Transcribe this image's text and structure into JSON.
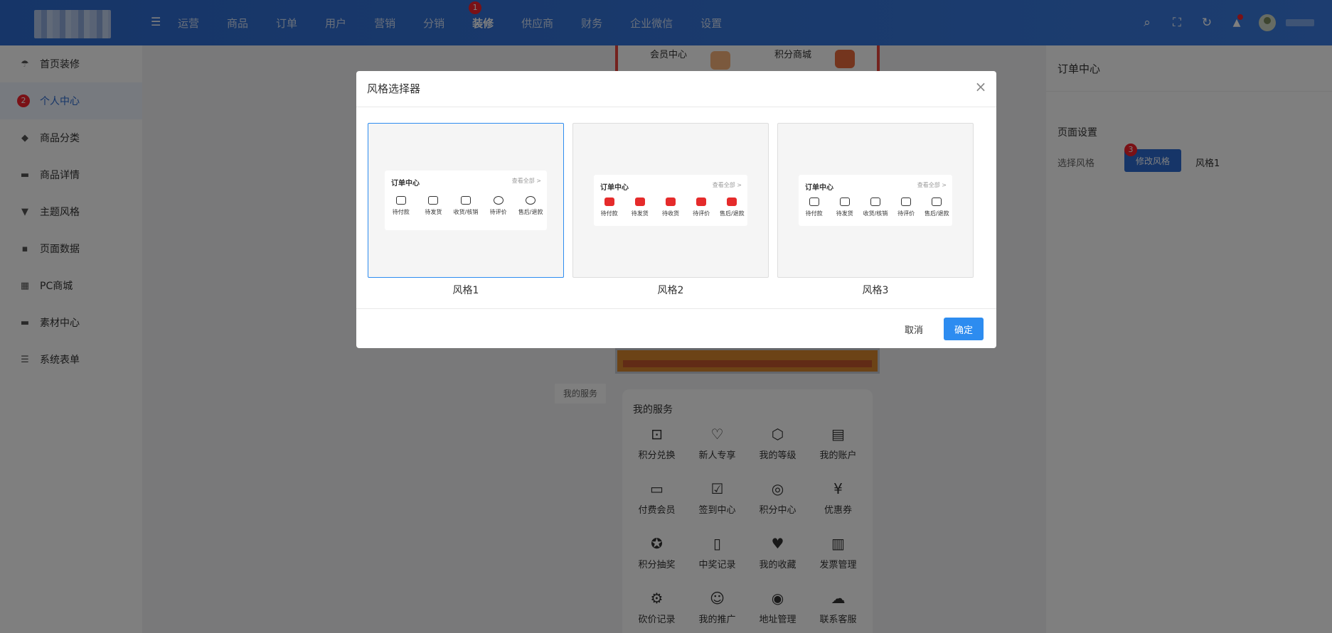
{
  "header": {
    "nav": [
      "运营",
      "商品",
      "订单",
      "用户",
      "营销",
      "分销",
      "装修",
      "供应商",
      "财务",
      "企业微信",
      "设置"
    ],
    "active_nav": "装修",
    "badges": {
      "nav": "1",
      "sidebar": "2",
      "modify": "3"
    },
    "tools": {
      "search": "⌕",
      "fullscreen": "⛶",
      "refresh": "↻",
      "bell": "🔔"
    }
  },
  "sidebar": {
    "items": [
      {
        "label": "首页装修",
        "icon": "umbrella-icon",
        "glyph": "☂"
      },
      {
        "label": "个人中心",
        "icon": "user-icon",
        "glyph": "●"
      },
      {
        "label": "商品分类",
        "icon": "tag-icon",
        "glyph": "◆"
      },
      {
        "label": "商品详情",
        "icon": "folder-icon",
        "glyph": "▬"
      },
      {
        "label": "主题风格",
        "icon": "shirt-icon",
        "glyph": "▼"
      },
      {
        "label": "页面数据",
        "icon": "database-icon",
        "glyph": "▪"
      },
      {
        "label": "PC商城",
        "icon": "windows-icon",
        "glyph": "▦"
      },
      {
        "label": "素材中心",
        "icon": "box-icon",
        "glyph": "▬"
      },
      {
        "label": "系统表单",
        "icon": "sliders-icon",
        "glyph": "☰"
      }
    ],
    "active": "个人中心"
  },
  "preview": {
    "member_center": "会员中心",
    "points_mall": "积分商城",
    "service_tag": "我的服务",
    "service_title": "我的服务",
    "services": [
      {
        "label": "积分兑换",
        "icon": "gift-box-icon",
        "glyph": "⊡"
      },
      {
        "label": "新人专享",
        "icon": "shopping-bag-icon",
        "glyph": "♡"
      },
      {
        "label": "我的等级",
        "icon": "level-icon",
        "glyph": "⬡"
      },
      {
        "label": "我的账户",
        "icon": "wallet-icon",
        "glyph": "▤"
      },
      {
        "label": "付费会员",
        "icon": "vip-icon",
        "glyph": "▭"
      },
      {
        "label": "签到中心",
        "icon": "calendar-icon",
        "glyph": "☑"
      },
      {
        "label": "积分中心",
        "icon": "coins-icon",
        "glyph": "◎"
      },
      {
        "label": "优惠券",
        "icon": "coupon-icon",
        "glyph": "¥"
      },
      {
        "label": "积分抽奖",
        "icon": "star-badge-icon",
        "glyph": "✪"
      },
      {
        "label": "中奖记录",
        "icon": "book-icon",
        "glyph": "▯"
      },
      {
        "label": "我的收藏",
        "icon": "heart-folder-icon",
        "glyph": "♥"
      },
      {
        "label": "发票管理",
        "icon": "invoice-icon",
        "glyph": "▥"
      },
      {
        "label": "砍价记录",
        "icon": "discount-icon",
        "glyph": "⚙"
      },
      {
        "label": "我的推广",
        "icon": "users-icon",
        "glyph": "☺"
      },
      {
        "label": "地址管理",
        "icon": "location-icon",
        "glyph": "◉"
      },
      {
        "label": "联系客服",
        "icon": "chat-icon",
        "glyph": "☁"
      }
    ]
  },
  "right_panel": {
    "title": "订单中心",
    "section": "页面设置",
    "style_label": "选择风格",
    "modify_button": "修改风格",
    "current_style": "风格1"
  },
  "dialog": {
    "title": "风格选择器",
    "close": "×",
    "options": [
      {
        "name": "风格1",
        "selected": true
      },
      {
        "name": "风格2",
        "selected": false
      },
      {
        "name": "风格3",
        "selected": false
      }
    ],
    "card": {
      "title": "订单中心",
      "more": "查看全部 >",
      "items": [
        "待付款",
        "待发货",
        "收货/核销",
        "待评价",
        "售后/退款"
      ],
      "items2": [
        "待付款",
        "待发货",
        "待收货",
        "待评价",
        "售后/退款"
      ]
    },
    "cancel": "取消",
    "confirm": "确定"
  },
  "colors": {
    "brand": "#2d6bd0",
    "primary": "#2d8cf0",
    "badge": "#f5222d",
    "accent_red": "#e52b2b"
  }
}
